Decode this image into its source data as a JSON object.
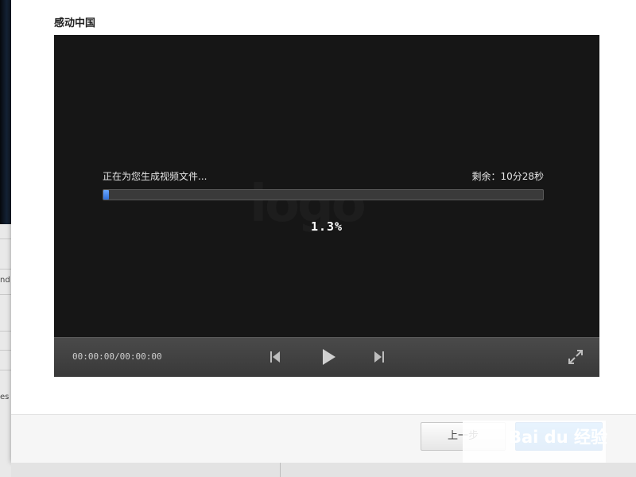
{
  "dialog": {
    "title": "感动中国"
  },
  "player": {
    "status_text": "正在为您生成视频文件...",
    "remaining_label": "剩余：",
    "remaining_value": "10分28秒",
    "progress_percent": 1.3,
    "percent_text": "1.3%",
    "timecode": "00:00:00/00:00:00",
    "accent_color": "#2f6fd8"
  },
  "controls": {
    "prev_icon": "skip-back-icon",
    "play_icon": "play-icon",
    "next_icon": "skip-forward-icon",
    "fullscreen_icon": "fullscreen-icon"
  },
  "footer": {
    "prev_label": "上一步",
    "watermark_text": "Bai du 经验"
  },
  "background": {
    "bits": [
      "nd",
      "es"
    ]
  }
}
